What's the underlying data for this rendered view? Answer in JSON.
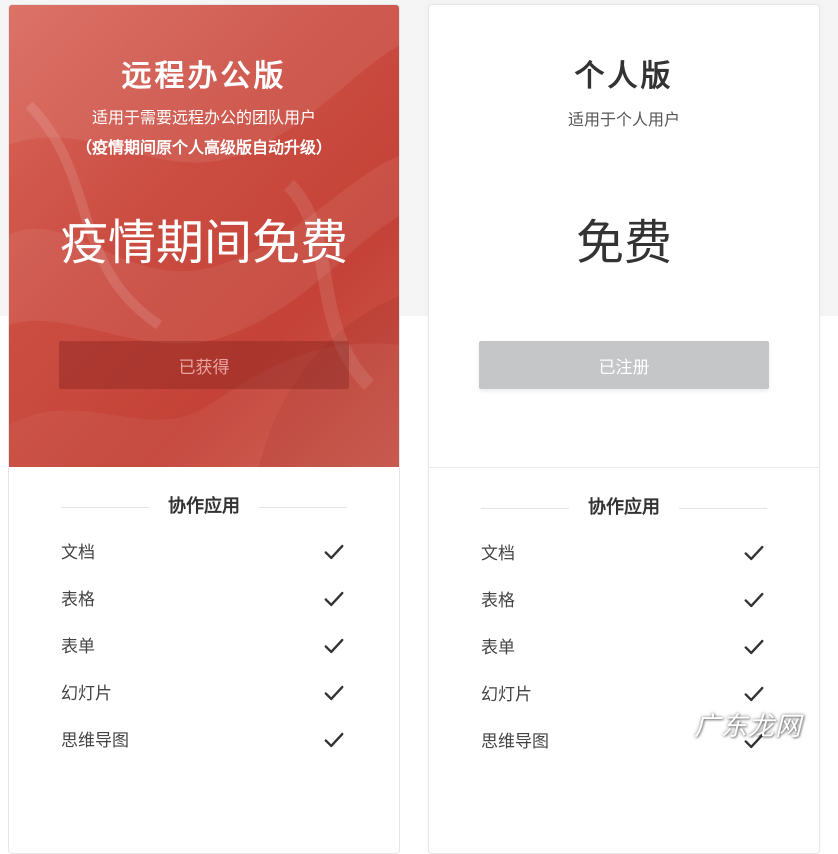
{
  "colors": {
    "accent_red": "#cb4d42",
    "page_bg": "#f5f5f6",
    "registered_btn": "#c5c6c8",
    "text_dark": "#333333"
  },
  "plans": [
    {
      "title": "远程办公版",
      "description": "适用于需要远程办公的团队用户",
      "note": "（疫情期间原个人高级版自动升级）",
      "price": "疫情期间免费",
      "button_label": "已获得",
      "section_title": "协作应用",
      "features": [
        "文档",
        "表格",
        "表单",
        "幻灯片",
        "思维导图"
      ],
      "feature_icon": "check-icon"
    },
    {
      "title": "个人版",
      "description": "适用于个人用户",
      "price": "免费",
      "button_label": "已注册",
      "section_title": "协作应用",
      "features": [
        "文档",
        "表格",
        "表单",
        "幻灯片",
        "思维导图"
      ],
      "feature_icon": "check-icon"
    }
  ],
  "watermark": "广东龙网"
}
